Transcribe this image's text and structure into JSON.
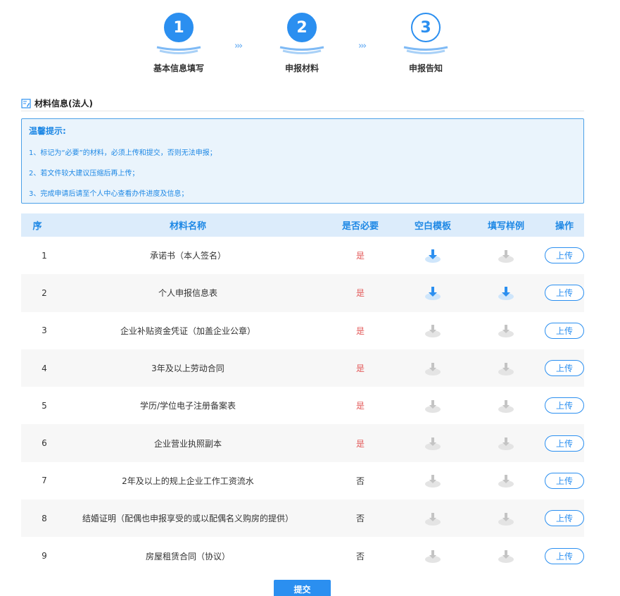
{
  "steps": [
    {
      "number": "1",
      "label": "基本信息填写",
      "state": "done"
    },
    {
      "number": "2",
      "label": "申报材料",
      "state": "current"
    },
    {
      "number": "3",
      "label": "申报告知",
      "state": "pending"
    }
  ],
  "step_separator": "›››",
  "section": {
    "title": "材料信息(法人)"
  },
  "tips": {
    "title": "温馨提示:",
    "lines": [
      "1、标记为“必要”的材料，必须上传和提交，否则无法申报；",
      "2、若文件较大建议压缩后再上传；",
      "3、完成申请后请至个人中心查看办件进度及信息；"
    ]
  },
  "table": {
    "headers": [
      "序",
      "材料名称",
      "是否必要",
      "空白模板",
      "填写样例",
      "操作"
    ],
    "rows": [
      {
        "no": "1",
        "name": "承诺书（本人签名）",
        "required": "是",
        "blank_available": true,
        "example_available": false,
        "action": "上传"
      },
      {
        "no": "2",
        "name": "个人申报信息表",
        "required": "是",
        "blank_available": true,
        "example_available": true,
        "action": "上传"
      },
      {
        "no": "3",
        "name": "企业补贴资金凭证（加盖企业公章）",
        "required": "是",
        "blank_available": false,
        "example_available": false,
        "action": "上传"
      },
      {
        "no": "4",
        "name": "3年及以上劳动合同",
        "required": "是",
        "blank_available": false,
        "example_available": false,
        "action": "上传"
      },
      {
        "no": "5",
        "name": "学历/学位电子注册备案表",
        "required": "是",
        "blank_available": false,
        "example_available": false,
        "action": "上传"
      },
      {
        "no": "6",
        "name": "企业营业执照副本",
        "required": "是",
        "blank_available": false,
        "example_available": false,
        "action": "上传"
      },
      {
        "no": "7",
        "name": "2年及以上的规上企业工作工资流水",
        "required": "否",
        "blank_available": false,
        "example_available": false,
        "action": "上传"
      },
      {
        "no": "8",
        "name": "结婚证明（配偶也申报享受的或以配偶名义购房的提供）",
        "required": "否",
        "blank_available": false,
        "example_available": false,
        "action": "上传"
      },
      {
        "no": "9",
        "name": "房屋租赁合同（协议）",
        "required": "否",
        "blank_available": false,
        "example_available": false,
        "action": "上传"
      }
    ]
  },
  "submit_label": "提交",
  "colors": {
    "accent": "#2b8ff0",
    "required_yes": "#e35b5b",
    "header_bg": "#dcecfb",
    "tips_bg": "#eaf4fc"
  }
}
